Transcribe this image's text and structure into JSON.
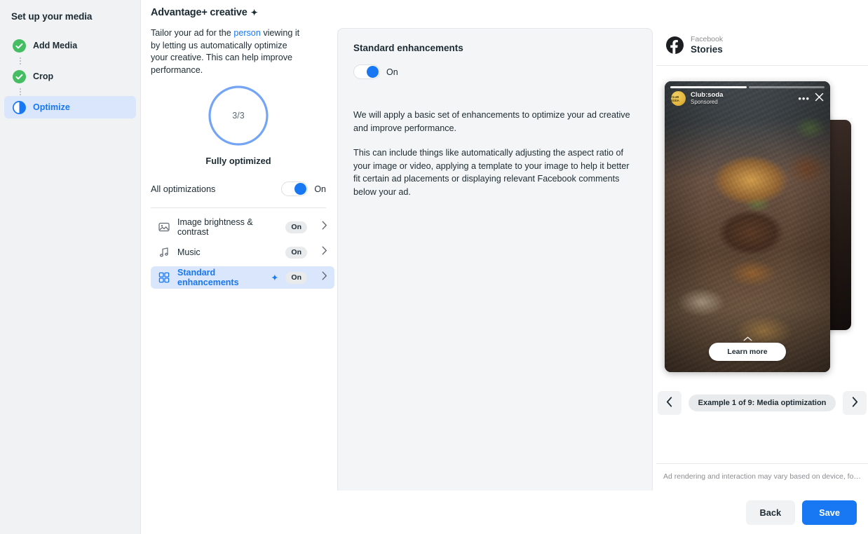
{
  "sidebar": {
    "title": "Set up your media",
    "steps": [
      {
        "label": "Add Media",
        "state": "complete",
        "icon": "check-circle-icon"
      },
      {
        "label": "Crop",
        "state": "complete",
        "icon": "check-circle-icon"
      },
      {
        "label": "Optimize",
        "state": "active",
        "icon": "half-circle-icon"
      }
    ]
  },
  "header": {
    "close_label": "✕"
  },
  "left_panel": {
    "title": "Advantage+ creative",
    "title_sparkle": "✦",
    "description_part1": "Tailor your ad for the ",
    "description_link": "person",
    "description_part2": " viewing it by letting us automatically optimize your creative. This can help improve performance.",
    "ring": {
      "value": "3/3",
      "completed": 3,
      "total": 3,
      "caption": "Fully optimized",
      "color": "#74a4f5",
      "track_color": "#e9eaec"
    },
    "all_optimizations": {
      "label": "All optimizations",
      "state": "On"
    },
    "options": [
      {
        "label": "Image brightness & contrast",
        "status": "On",
        "icon": "image-icon",
        "selected": false,
        "sparkle": ""
      },
      {
        "label": "Music",
        "status": "On",
        "icon": "music-note-icon",
        "selected": false,
        "sparkle": ""
      },
      {
        "label": "Standard enhancements",
        "status": "On",
        "icon": "template-grid-icon",
        "selected": true,
        "sparkle": "✦"
      }
    ]
  },
  "center_panel": {
    "title": "Standard enhancements",
    "toggle_state": "On",
    "paragraph1": "We will apply a basic set of enhancements to optimize your ad creative and improve performance.",
    "paragraph2": "This can include things like automatically adjusting the aspect ratio of your image or video, applying a template to your image to help it better fit certain ad placements or displaying relevant Facebook comments below your ad."
  },
  "preview": {
    "platform": "Facebook",
    "placement": "Stories",
    "story": {
      "advertiser": "Club:soda",
      "sponsored_label": "Sponsored",
      "avatar_text": "CLUB SODA",
      "cta_label": "Learn more",
      "menu_label": "•••",
      "close_label": "✕"
    },
    "carousel": {
      "prev_label": "‹",
      "next_label": "›",
      "label": "Example 1 of 9: Media optimization",
      "current": 1,
      "total": 9
    },
    "disclaimer": "Ad rendering and interaction may vary based on device, form..."
  },
  "footer": {
    "back_label": "Back",
    "save_label": "Save"
  },
  "colors": {
    "accent": "#1877f2",
    "success": "#45bd62",
    "selected_bg": "#d9e6fb",
    "panel_bg": "#f4f5f6",
    "sidebar_bg": "#f1f2f3"
  }
}
